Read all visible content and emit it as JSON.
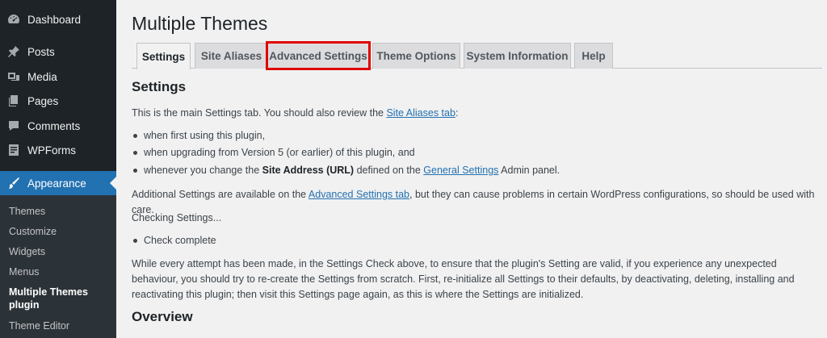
{
  "sidebar": {
    "items": [
      {
        "label": "Dashboard",
        "icon": "dashboard-icon"
      },
      {
        "label": "Posts",
        "icon": "pin-icon"
      },
      {
        "label": "Media",
        "icon": "media-icon"
      },
      {
        "label": "Pages",
        "icon": "pages-icon"
      },
      {
        "label": "Comments",
        "icon": "comment-icon"
      },
      {
        "label": "WPForms",
        "icon": "forms-icon"
      },
      {
        "label": "Appearance",
        "icon": "brush-icon"
      }
    ],
    "submenu": [
      "Themes",
      "Customize",
      "Widgets",
      "Menus",
      "Multiple Themes plugin",
      "Theme Editor"
    ]
  },
  "page": {
    "title": "Multiple Themes",
    "tabs": [
      "Settings",
      "Site Aliases",
      "Advanced Settings",
      "Theme Options",
      "System Information",
      "Help"
    ],
    "active_tab": "Settings",
    "highlighted_tab": "Advanced Settings",
    "highlight_color": "#e00000"
  },
  "content": {
    "settings_heading": "Settings",
    "intro_text": "This is the main Settings tab. You should also review the ",
    "intro_link": "Site Aliases tab",
    "intro_end": ":",
    "bullet1": "when first using this plugin,",
    "bullet2": "when upgrading from Version 5 (or earlier) of this plugin, and",
    "bullet3_a": "whenever you change the ",
    "bullet3_bold": "Site Address (URL)",
    "bullet3_b": " defined on the ",
    "bullet3_link": "General Settings",
    "bullet3_c": " Admin panel.",
    "additional_a": "Additional Settings are available on the ",
    "additional_link": "Advanced Settings tab",
    "additional_b": ", but they can cause problems in certain WordPress configurations, so should be used with care.",
    "checking": "Checking Settings...",
    "check_complete": "Check complete",
    "warning": "While every attempt has been made, in the Settings Check above, to ensure that the plugin's Setting are valid, if you experience any unexpected behaviour, you should try to re-create the Settings from scratch. First, re-initialize all Settings to their defaults, by deactivating, deleting, installing and reactivating this plugin; then visit this Settings page again, as this is where the Settings are initialized.",
    "overview_heading": "Overview"
  },
  "colors": {
    "sidebar_bg": "#1d2327",
    "submenu_bg": "#2c3338",
    "accent": "#2271b1",
    "page_bg": "#f1f1f1"
  }
}
